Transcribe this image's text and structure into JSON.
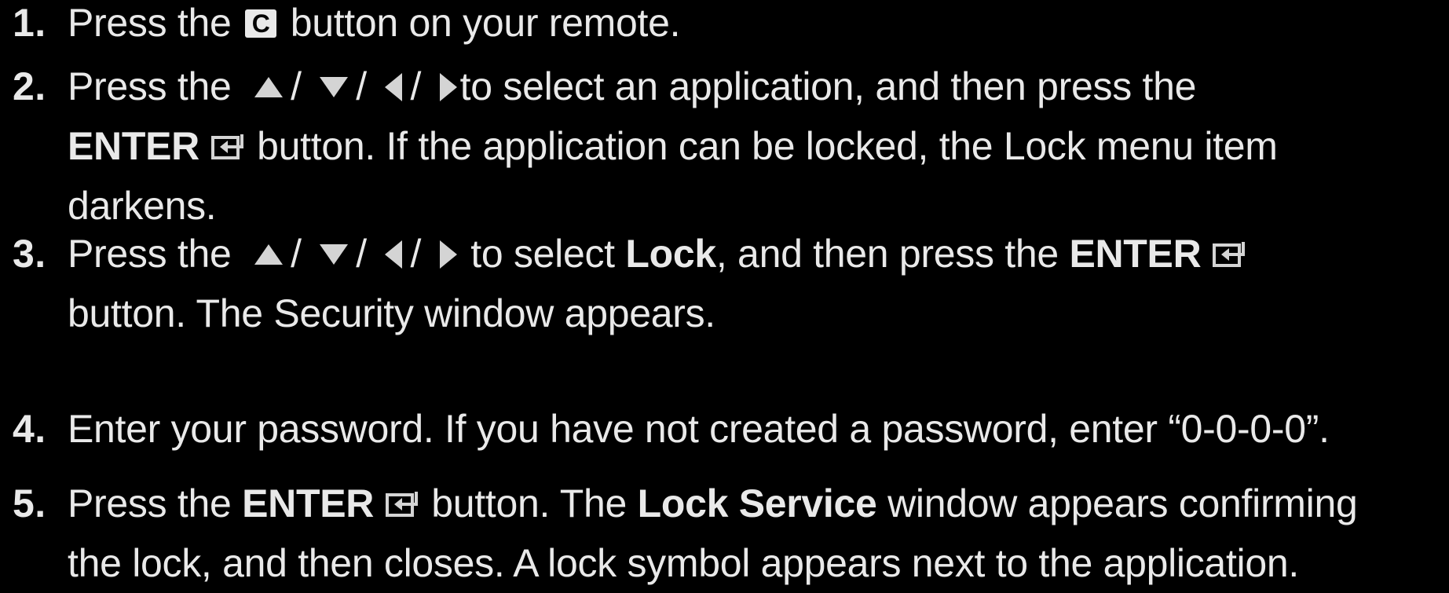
{
  "steps": [
    {
      "number": "1.",
      "pre": "Press the",
      "c_key": "C",
      "post": "button on your remote."
    },
    {
      "number": "2.",
      "pre": "Press the",
      "sep": "/",
      "line1_post": "to select an application, and then press the",
      "enter": "ENTER",
      "line2_post": " button. If the application can be locked, the Lock menu item",
      "line3": "darkens."
    },
    {
      "number": "3.",
      "pre": "Press the",
      "sep": "/",
      "mid": " to select ",
      "lock": "Lock",
      "mid2": ", and then press the ",
      "enter": "ENTER",
      "line2": "button. The Security window appears."
    },
    {
      "number": "4.",
      "text": "Enter your password. If you have not created a password, enter “0-0-0-0”."
    },
    {
      "number": "5.",
      "pre": "Press the ",
      "enter": "ENTER",
      "mid": " button. The ",
      "lock_service": "Lock Service",
      "post": " window appears confirming",
      "line2": "the lock, and then closes. A lock symbol appears next to the application."
    }
  ],
  "icons": {
    "c_button": "c-button-icon",
    "up": "triangle-up-icon",
    "down": "triangle-down-icon",
    "left": "triangle-left-icon",
    "right": "triangle-right-icon",
    "enter": "enter-icon"
  },
  "colors": {
    "background": "#000000",
    "text": "#e9e9e9"
  }
}
